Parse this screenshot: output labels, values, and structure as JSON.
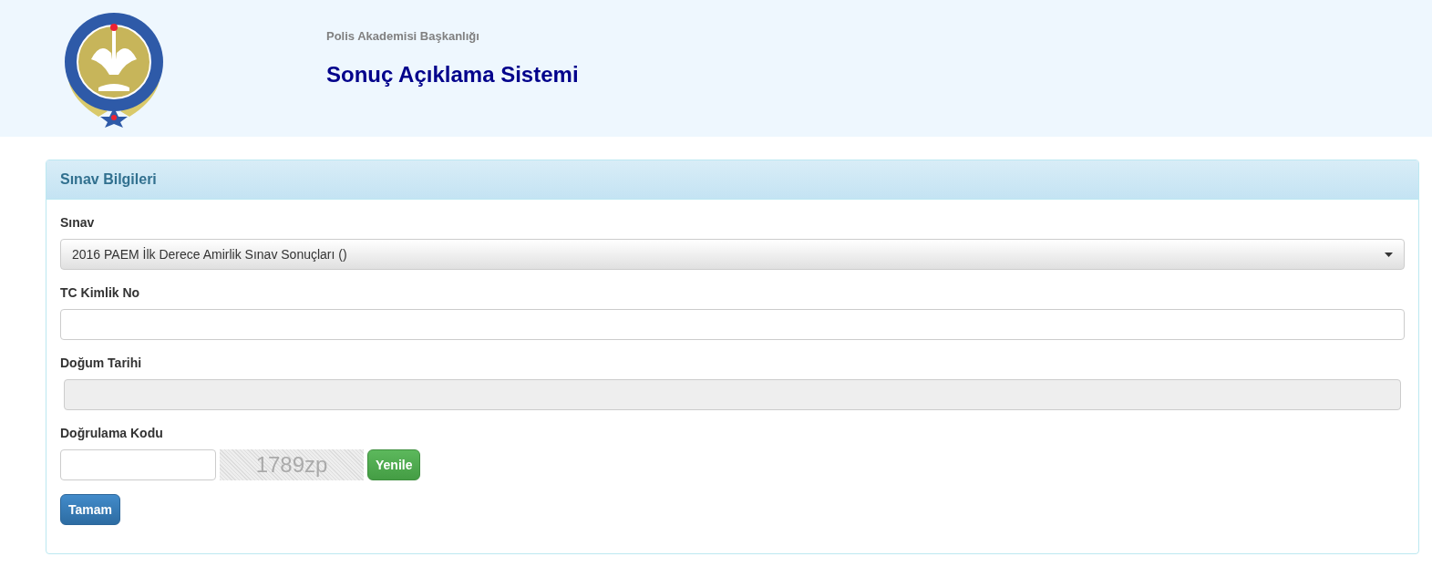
{
  "header": {
    "subtitle": "Polis Akademisi Başkanlığı",
    "title": "Sonuç Açıklama Sistemi"
  },
  "panel": {
    "title": "Sınav Bilgileri",
    "fields": [
      {
        "kind": "select",
        "label": "Sınav",
        "value": "2016 PAEM İlk Derece Amirlik Sınav Sonuçları ()",
        "disabled": false
      },
      {
        "kind": "text",
        "label": "TC Kimlik No",
        "disabled": false
      },
      {
        "kind": "text",
        "label": "Doğum Tarihi",
        "disabled": true
      },
      {
        "kind": "captcha",
        "label": "Doğrulama Kodu",
        "captcha": "1789zp",
        "refresh": "Yenile",
        "disabled": false
      }
    ],
    "submit": "Tamam"
  }
}
